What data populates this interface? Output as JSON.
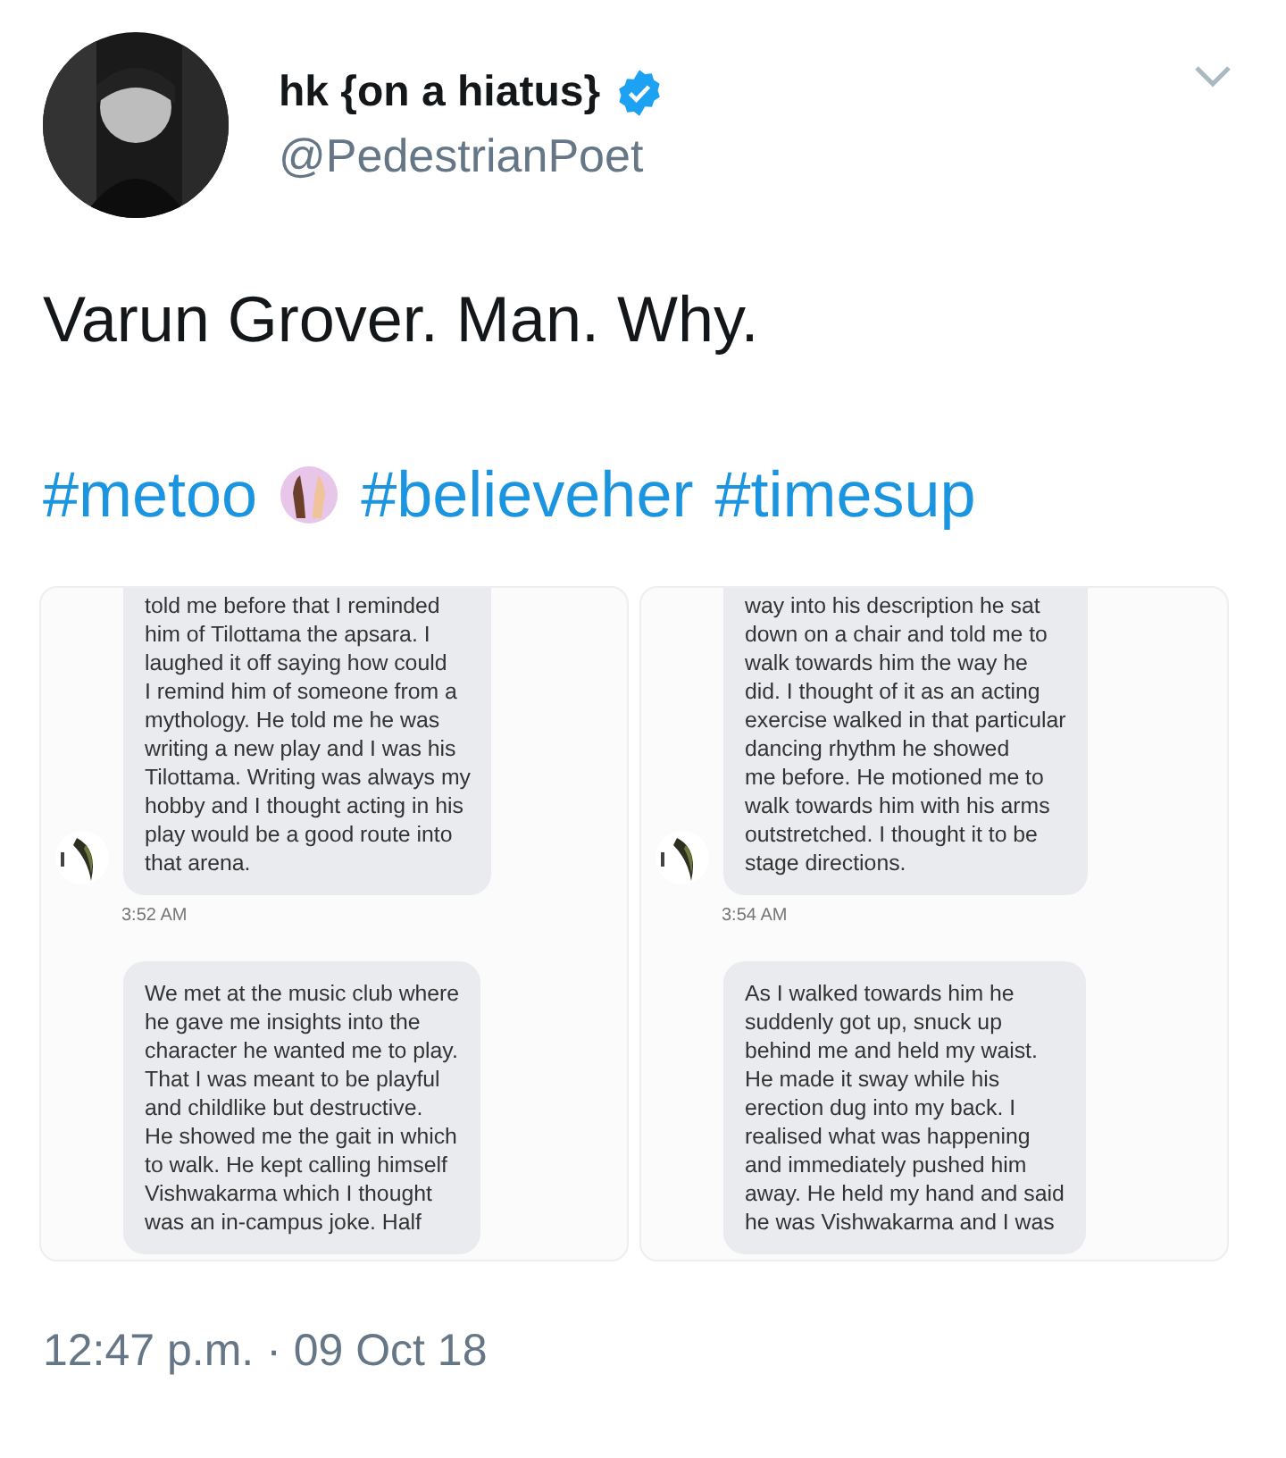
{
  "author": {
    "name": "hk {on a hiatus}",
    "verified": true,
    "handle": "@PedestrianPoet"
  },
  "text": "Varun Grover. Man. Why.",
  "hashtags": [
    {
      "kind": "hashtag",
      "tag": "#metoo"
    },
    {
      "kind": "emoji"
    },
    {
      "kind": "hashtag",
      "tag": "#believeher"
    },
    {
      "kind": "hashtag",
      "tag": "#timesup"
    }
  ],
  "images": [
    {
      "messages": [
        {
          "text": "told me before that I reminded\nhim of Tilottama the apsara. I\nlaughed it off saying how could\nI remind him of someone from a\nmythology. He told me he was\nwriting a new play and I was his\nTilottama. Writing was always my\nhobby and I thought acting in his\nplay would be a good route into\nthat arena.",
          "time": "3:52 AM"
        },
        {
          "text": "We met at the music club where\nhe gave me insights into the\ncharacter he wanted me to play.\nThat I was meant to be playful\nand childlike but destructive.\nHe showed me the gait in which\nto walk. He kept calling himself\nVishwakarma which I thought\nwas an in-campus joke. Half"
        }
      ]
    },
    {
      "messages": [
        {
          "text": "way into his description he sat\ndown on a chair and told me to\nwalk towards him the way he\ndid. I thought of it as an acting\nexercise walked in that particular\ndancing rhythm he showed\nme before. He motioned me to\nwalk towards him with his arms\noutstretched. I thought it to be\nstage directions.",
          "time": "3:54 AM"
        },
        {
          "text": "As I walked towards him he\nsuddenly got up, snuck up\nbehind me and held my waist.\nHe made it sway while his\nerection dug into my back. I\nrealised what was happening\nand immediately pushed him\naway. He held my hand and said\nhe was Vishwakarma and I was"
        }
      ]
    }
  ],
  "timestamp": "12:47 p.m. · 09 Oct 18"
}
